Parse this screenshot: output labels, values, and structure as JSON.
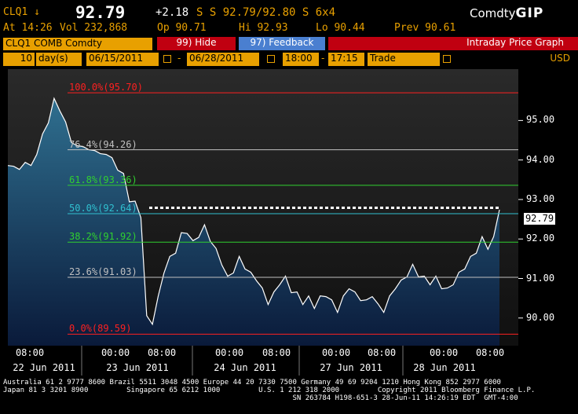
{
  "header": {
    "ticker": "CLQ1 ↓",
    "price": "92.79",
    "change": "+2.18",
    "bid_ask": "S S 92.79/92.80 S   6x4",
    "brand_prefix": "Comdty",
    "brand_suffix": "GIP"
  },
  "quote_line": {
    "time": "At 14:26",
    "vol": "Vol 232,868",
    "open": "Op 90.71",
    "high": "Hi 92.93",
    "low": "Lo 90.44",
    "prev": "Prev 90.61"
  },
  "toolbar": {
    "security": "CLQ1 COMB Comdty",
    "hide_label": "99) Hide",
    "feedback_label": "97)  Feedback",
    "title": "Intraday Price Graph"
  },
  "range_bar": {
    "period_value": "10",
    "period_unit": "day(s)",
    "start_date": "06/15/2011",
    "end_date": "06/28/2011",
    "dash": "-",
    "start_time": "18:00",
    "end_time": "17:15",
    "type": "Trade",
    "currency": "USD"
  },
  "chart_data": {
    "type": "line",
    "y_axis": {
      "ticks": [
        "95.00",
        "94.00",
        "93.00",
        "92.00",
        "91.00",
        "90.00"
      ],
      "range": [
        89.3,
        96.3
      ]
    },
    "last_price": "92.79",
    "fib_levels": [
      {
        "label": "100.0%(95.70)",
        "value": 95.7,
        "color": "#ff2020"
      },
      {
        "label": "76.4%(94.26)",
        "value": 94.26,
        "color": "#c0c0c0"
      },
      {
        "label": "61.8%(93.36)",
        "value": 93.36,
        "color": "#30d030"
      },
      {
        "label": "50.0%(92.64)",
        "value": 92.64,
        "color": "#30c0d0"
      },
      {
        "label": "38.2%(91.92)",
        "value": 91.92,
        "color": "#30d030"
      },
      {
        "label": "23.6%(91.03)",
        "value": 91.03,
        "color": "#c0c0c0"
      },
      {
        "label": "0.0%(89.59)",
        "value": 89.59,
        "color": "#ff2020"
      }
    ],
    "x_axis": {
      "times": [
        "08:00",
        "00:00",
        "08:00",
        "00:00",
        "08:00",
        "00:00",
        "08:00",
        "00:00",
        "08:00"
      ],
      "dates": [
        "22 Jun 2011",
        "23 Jun 2011",
        "24 Jun 2011",
        "27 Jun 2011",
        "28 Jun 2011"
      ]
    },
    "series": [
      {
        "values": [
          93.8,
          93.9,
          93.7,
          94.0,
          93.8,
          94.2,
          94.6,
          95.0,
          95.5,
          95.3,
          94.9,
          94.5,
          94.3,
          94.4,
          94.2,
          94.3,
          94.1,
          94.2,
          94.0,
          93.8,
          93.6,
          93.0,
          92.9,
          92.6,
          90.0,
          89.9,
          90.5,
          91.2,
          91.5,
          91.7,
          92.1,
          92.2,
          91.9,
          92.1,
          92.3,
          92.0,
          91.7,
          91.4,
          91.0,
          91.2,
          91.5,
          91.3,
          91.1,
          91.0,
          90.7,
          90.4,
          90.6,
          90.9,
          91.0,
          90.7,
          90.6,
          90.4,
          90.5,
          90.3,
          90.5,
          90.6,
          90.4,
          90.2,
          90.5,
          90.8,
          90.6,
          90.5,
          90.4,
          90.6,
          90.3,
          90.2,
          90.5,
          90.8,
          90.9,
          91.1,
          91.3,
          91.1,
          91.0,
          90.9,
          91.0,
          90.8,
          90.7,
          90.9,
          91.1,
          91.3,
          91.5,
          91.7,
          92.0,
          91.8,
          92.0,
          92.8
        ]
      }
    ]
  },
  "footer": {
    "line1": "Australia 61 2 9777 8600 Brazil 5511 3048 4500 Europe 44 20 7330 7500 Germany 49 69 9204 1210 Hong Kong 852 2977 6000",
    "line2": "Japan 81 3 3201 8900         Singapore 65 6212 1000         U.S. 1 212 318 2000         Copyright 2011 Bloomberg Finance L.P.",
    "line3": "                                                                    SN 263784 H198-651-3 28-Jun-11 14:26:19 EDT  GMT-4:00"
  }
}
